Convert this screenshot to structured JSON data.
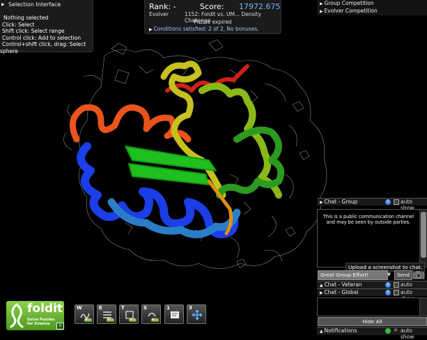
{
  "selection_panel": {
    "title": "Selection Interface",
    "lines": [
      "Nothing selected",
      "Click: Select",
      "Shift click: Select range",
      "Control click: Add to selection",
      "Control+shift click, drag: Select",
      "sphere"
    ]
  },
  "score_panel": {
    "rank_label": "Rank: -",
    "score_label": "Score:",
    "score_value": "17972.675",
    "evolver_label": "Evolver",
    "puzzle_title": "1152: Foldit vs. UM... Density Challenge",
    "puzzle_status": "Puzzle expired",
    "conditions": "Conditions satisfied: 2 of 2, No bonuses."
  },
  "competitions": [
    "Group Competition",
    "Evolver Competition"
  ],
  "chat": {
    "group_label": "Chat - Group",
    "auto_show": "auto show",
    "notice": "This is a public communication channel and may be seen by outside parties.",
    "input_value": "Great Group Effort!",
    "send_label": "Send",
    "tooltip": "Upload a screenshot to chat.",
    "veteran_label": "Chat - Veteran",
    "global_label": "Chat - Global",
    "hide_all": "Hide All",
    "notifications_label": "Notifications"
  },
  "logo": {
    "word": "foldit",
    "tagline_1": "Solve Puzzles",
    "tagline_2": "for Science",
    "help_key": "H",
    "trademark": "beta"
  },
  "toolbar": [
    {
      "key": "W",
      "icon": "wiggle-all-icon",
      "badge": "ALL"
    },
    {
      "key": "E",
      "icon": "shake-all-icon",
      "badge": "ALL"
    },
    {
      "key": "T",
      "icon": "tweak-all-icon",
      "badge": "ALL"
    },
    {
      "key": "S",
      "icon": "rebuild-all-icon",
      "badge": "ALL"
    },
    {
      "key": "1",
      "icon": "recipe-icon",
      "badge": ""
    },
    {
      "key": "3",
      "icon": "move-icon",
      "badge": ""
    }
  ],
  "colors": {
    "score": "#6fb8ff",
    "accent_blue": "#3d8be8",
    "logo_green": "#7cc23c"
  }
}
